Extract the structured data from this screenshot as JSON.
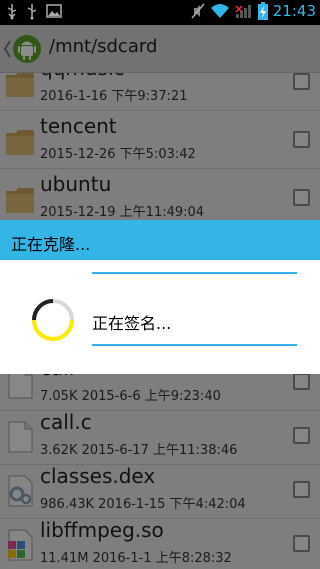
{
  "status_bar": {
    "time": "21:43",
    "left_icons": [
      "usb-icon",
      "usb-icon",
      "image-icon"
    ],
    "right_icons": [
      "mute-icon",
      "wifi-icon",
      "signal-icon",
      "battery-charging-icon"
    ]
  },
  "app_bar": {
    "path": "/mnt/sdcard",
    "logo_icon": "android-icon"
  },
  "files": [
    {
      "name": "qqmusic",
      "meta": "2016-1-16 下午9:37:21",
      "icon": "folder-icon"
    },
    {
      "name": "tencent",
      "meta": "2015-12-26 下午5:03:42",
      "icon": "folder-icon"
    },
    {
      "name": "ubuntu",
      "meta": "2015-12-19 上午11:49:04",
      "icon": "folder-icon"
    },
    {
      "name": "call",
      "meta": "7.05K  2015-6-6 上午9:23:40",
      "icon": "file-icon"
    },
    {
      "name": "call.c",
      "meta": "3.62K  2015-6-17 上午11:38:46",
      "icon": "file-icon"
    },
    {
      "name": "classes.dex",
      "meta": "986.43K  2016-1-15 下午4:42:04",
      "icon": "settings-file-icon"
    },
    {
      "name": "libffmpeg.so",
      "meta": "11.41M  2016-1-1 上午8:28:32",
      "icon": "library-file-icon"
    }
  ],
  "dialog": {
    "title": "正在克隆...",
    "message": "正在签名..."
  },
  "colors": {
    "accent": "#33b5e5",
    "spinner_yellow": "#ffeb00"
  }
}
